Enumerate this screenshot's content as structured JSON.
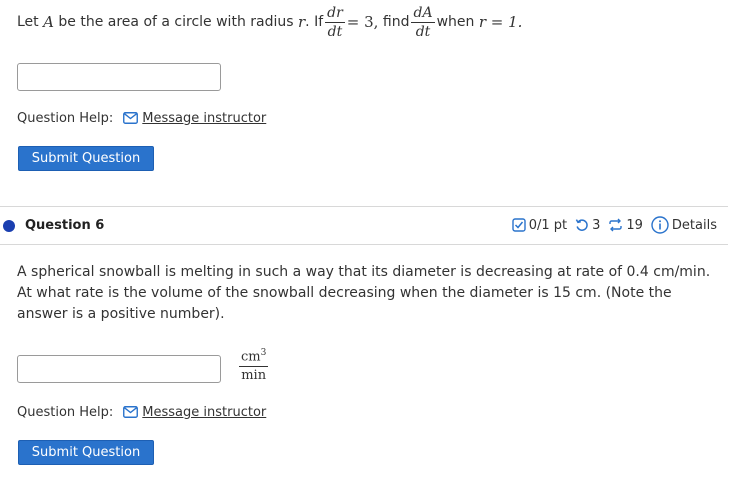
{
  "question5": {
    "text_prefix": "Let",
    "var_A": "A",
    "text_mid": "be the area of a circle with radius",
    "var_r": "r",
    "text_if": ". If",
    "frac1_num": "dr",
    "frac1_den": "dt",
    "equals_value": "= 3,",
    "text_find": "find",
    "frac2_num": "dA",
    "frac2_den": "dt",
    "text_when": "when",
    "condition": "r = 1.",
    "answer_value": "",
    "help_label": "Question Help:",
    "help_link": "Message instructor",
    "submit_label": "Submit Question"
  },
  "question6": {
    "title": "Question 6",
    "score": "0/1 pt",
    "retries": "3",
    "attempts": "19",
    "details_label": "Details",
    "body": "A spherical snowball is melting in such a way that its diameter is decreasing at rate of 0.4 cm/min. At what rate is the volume of the snowball decreasing when the diameter is 15 cm. (Note the answer is a positive number).",
    "answer_value": "",
    "unit_num": "cm",
    "unit_num_exp": "3",
    "unit_den": "min",
    "help_label": "Question Help:",
    "help_link": "Message instructor",
    "submit_label": "Submit Question"
  },
  "colors": {
    "accent": "#2a73cc",
    "status_dot": "#1a3fb0"
  }
}
